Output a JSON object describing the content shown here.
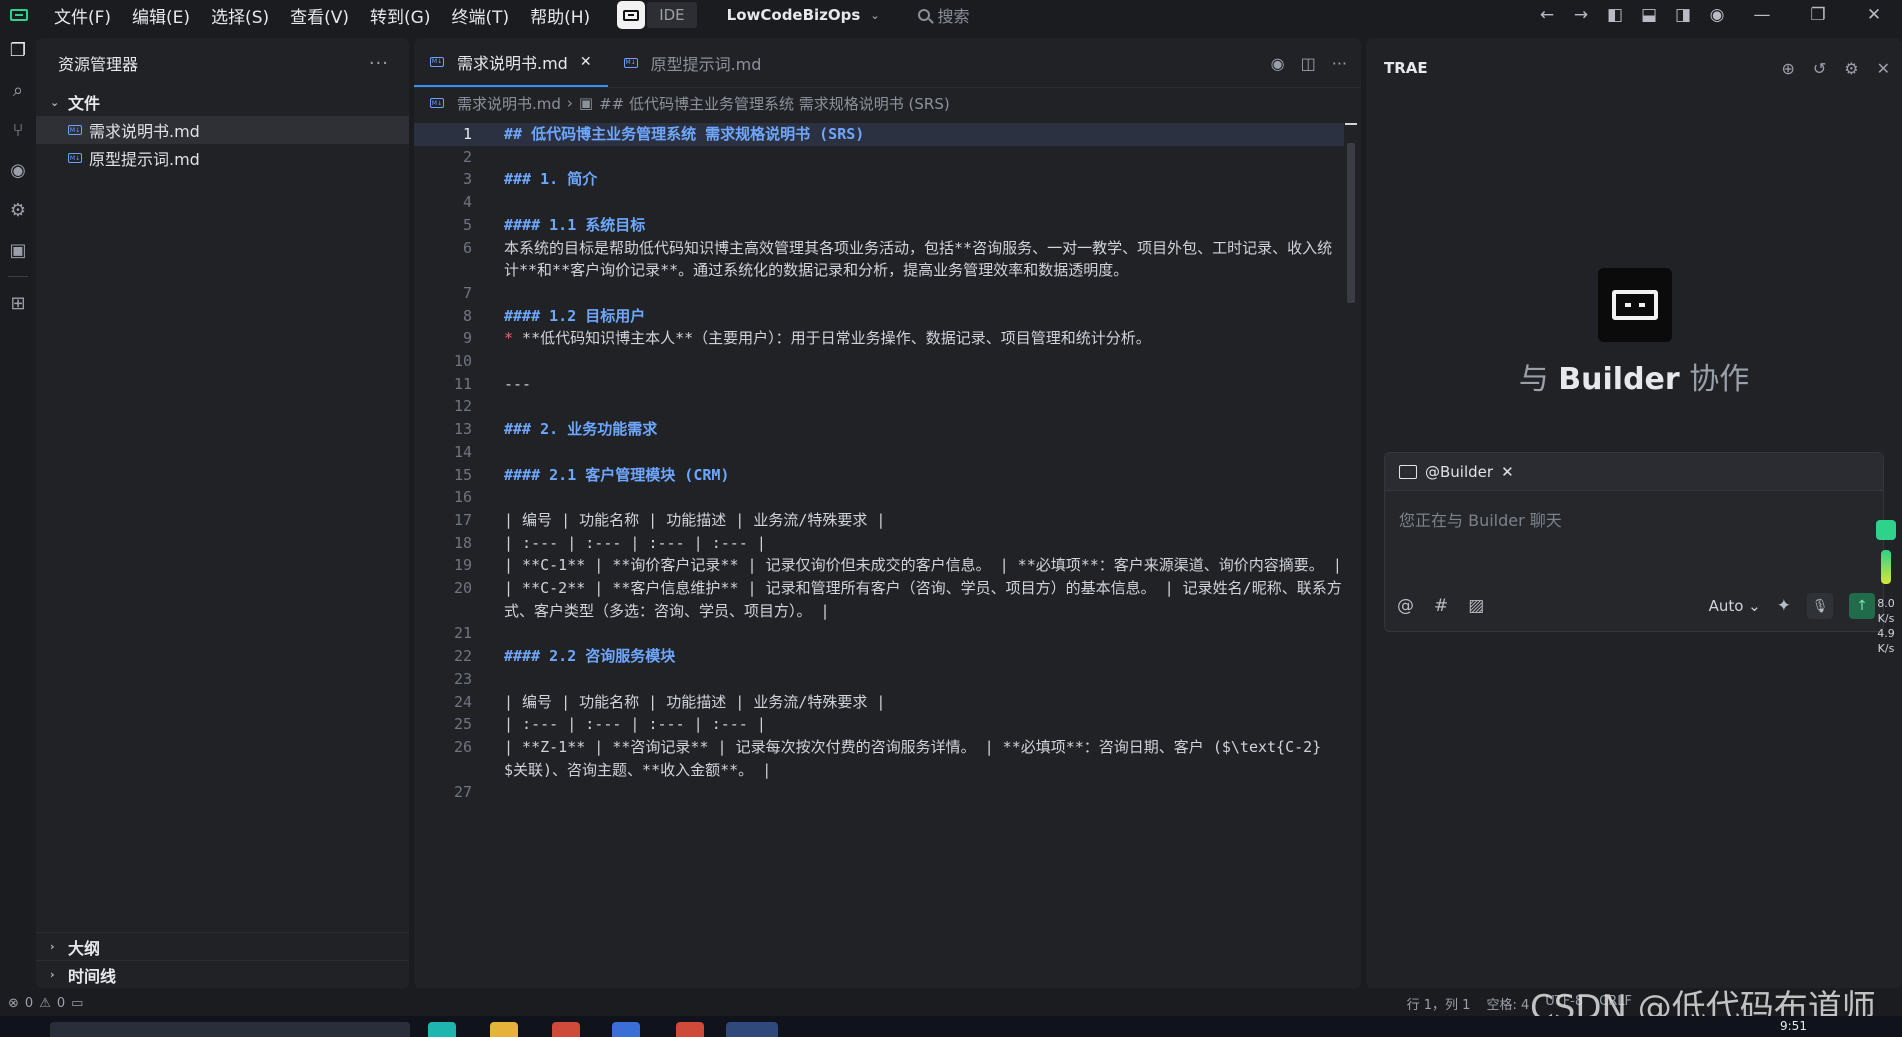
{
  "menu": [
    "文件(F)",
    "编辑(E)",
    "选择(S)",
    "查看(V)",
    "转到(G)",
    "终端(T)",
    "帮助(H)"
  ],
  "ide_label": "IDE",
  "project_name": "LowCodeBizOps",
  "search_placeholder": "搜索",
  "explorer": {
    "title": "资源管理器",
    "more": "···",
    "section_files": "文件",
    "files": [
      "需求说明书.md",
      "原型提示词.md"
    ],
    "section_outline": "大纲",
    "section_timeline": "时间线"
  },
  "editor": {
    "tabs": [
      {
        "label": "需求说明书.md",
        "active": true
      },
      {
        "label": "原型提示词.md",
        "active": false
      }
    ],
    "breadcrumb": [
      "需求说明书.md",
      "## 低代码博主业务管理系统 需求规格说明书 (SRS)"
    ],
    "lines": [
      {
        "n": "1",
        "text": "## 低代码博主业务管理系统 需求规格说明书 (SRS)",
        "type": "h"
      },
      {
        "n": "2",
        "text": "",
        "type": ""
      },
      {
        "n": "3",
        "text": "### 1. 简介",
        "type": "h"
      },
      {
        "n": "4",
        "text": "",
        "type": ""
      },
      {
        "n": "5",
        "text": "#### 1.1 系统目标",
        "type": "h"
      },
      {
        "n": "6",
        "text": "本系统的目标是帮助低代码知识博主高效管理其各项业务活动，包括**咨询服务、一对一教学、项目外包、工时记录、收入统计**和**客户询价记录**。通过系统化的数据记录和分析，提高业务管理效率和数据透明度。",
        "type": ""
      },
      {
        "n": "7",
        "text": "",
        "type": ""
      },
      {
        "n": "8",
        "text": "#### 1.2 目标用户",
        "type": "h"
      },
      {
        "n": "9",
        "text": "* **低代码知识博主本人**（主要用户）：用于日常业务操作、数据记录、项目管理和统计分析。",
        "type": "bul"
      },
      {
        "n": "10",
        "text": "",
        "type": ""
      },
      {
        "n": "11",
        "text": "---",
        "type": ""
      },
      {
        "n": "12",
        "text": "",
        "type": ""
      },
      {
        "n": "13",
        "text": "### 2. 业务功能需求",
        "type": "h"
      },
      {
        "n": "14",
        "text": "",
        "type": ""
      },
      {
        "n": "15",
        "text": "#### 2.1 客户管理模块 (CRM)",
        "type": "h"
      },
      {
        "n": "16",
        "text": "",
        "type": ""
      },
      {
        "n": "17",
        "text": "| 编号 | 功能名称 | 功能描述 | 业务流/特殊要求 |",
        "type": ""
      },
      {
        "n": "18",
        "text": "| :--- | :--- | :--- | :--- |",
        "type": ""
      },
      {
        "n": "19",
        "text": "| **C-1** | **询价客户记录** | 记录仅询价但未成交的客户信息。 | **必填项**：客户来源渠道、询价内容摘要。 |",
        "type": ""
      },
      {
        "n": "20",
        "text": "| **C-2** | **客户信息维护** | 记录和管理所有客户（咨询、学员、项目方）的基本信息。 | 记录姓名/昵称、联系方式、客户类型（多选：咨询、学员、项目方）。 |",
        "type": ""
      },
      {
        "n": "21",
        "text": "",
        "type": ""
      },
      {
        "n": "22",
        "text": "#### 2.2 咨询服务模块",
        "type": "h"
      },
      {
        "n": "23",
        "text": "",
        "type": ""
      },
      {
        "n": "24",
        "text": "| 编号 | 功能名称 | 功能描述 | 业务流/特殊要求 |",
        "type": ""
      },
      {
        "n": "25",
        "text": "| :--- | :--- | :--- | :--- |",
        "type": ""
      },
      {
        "n": "26",
        "text": "| **Z-1** | **咨询记录** | 记录每次按次付费的咨询服务详情。 | **必填项**：咨询日期、客户 ($\\text{C-2}$关联)、咨询主题、**收入金额**。 |",
        "type": ""
      },
      {
        "n": "27",
        "text": "",
        "type": ""
      }
    ]
  },
  "right_panel": {
    "title": "TRAE",
    "heading_prefix": "与",
    "heading_bold": "Builder",
    "heading_suffix": "协作",
    "chat_agent": "@Builder",
    "chat_placeholder": "您正在与 Builder 聊天",
    "mode": "Auto",
    "net_up": "8.0",
    "net_up_unit": "K/s",
    "net_down": "4.9",
    "net_down_unit": "K/s"
  },
  "statusbar": {
    "errors": "0",
    "warnings": "0",
    "position": "行 1，列 1",
    "spaces": "空格: 4",
    "encoding": "UTF-8",
    "eol": "CRLF"
  },
  "watermark": "CSDN @低代码布道师",
  "clock": "9:51"
}
